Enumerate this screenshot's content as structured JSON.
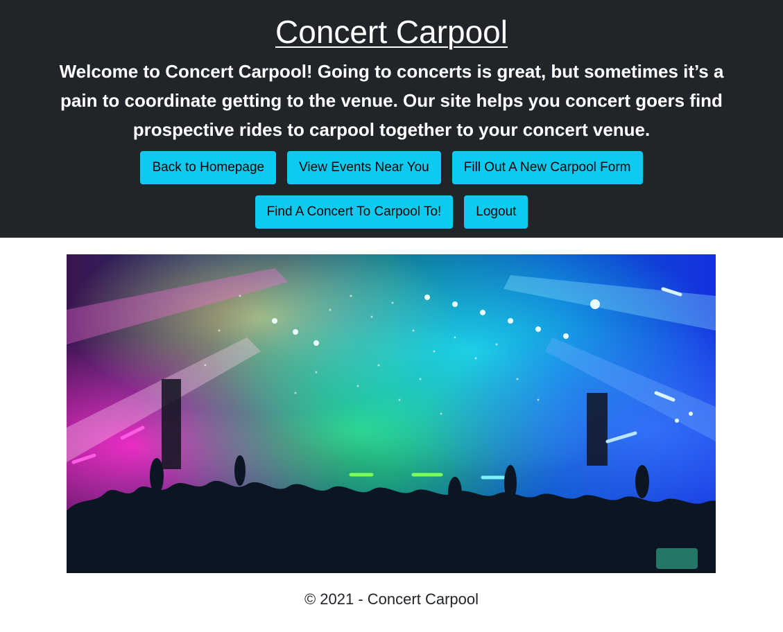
{
  "header": {
    "title": "Concert Carpool",
    "intro": "Welcome to Concert Carpool! Going to concerts is great, but sometimes it’s a pain to coordinate getting to the venue. Our site helps you concert goers find prospective rides to carpool together to your concert venue."
  },
  "nav": {
    "row1": {
      "back_home": "Back to Homepage",
      "view_events": "View Events Near You",
      "new_form": "Fill Out A New Carpool Form"
    },
    "row2": {
      "find_concert": "Find A Concert To Carpool To!",
      "logout": "Logout"
    }
  },
  "hero": {
    "alt": "concert crowd with colorful stage lights"
  },
  "footer": {
    "text": "© 2021 - Concert Carpool"
  },
  "colors": {
    "header_bg": "#212529",
    "button_bg": "#0dcaf0",
    "button_text": "#000000",
    "footer_text": "#212529"
  }
}
